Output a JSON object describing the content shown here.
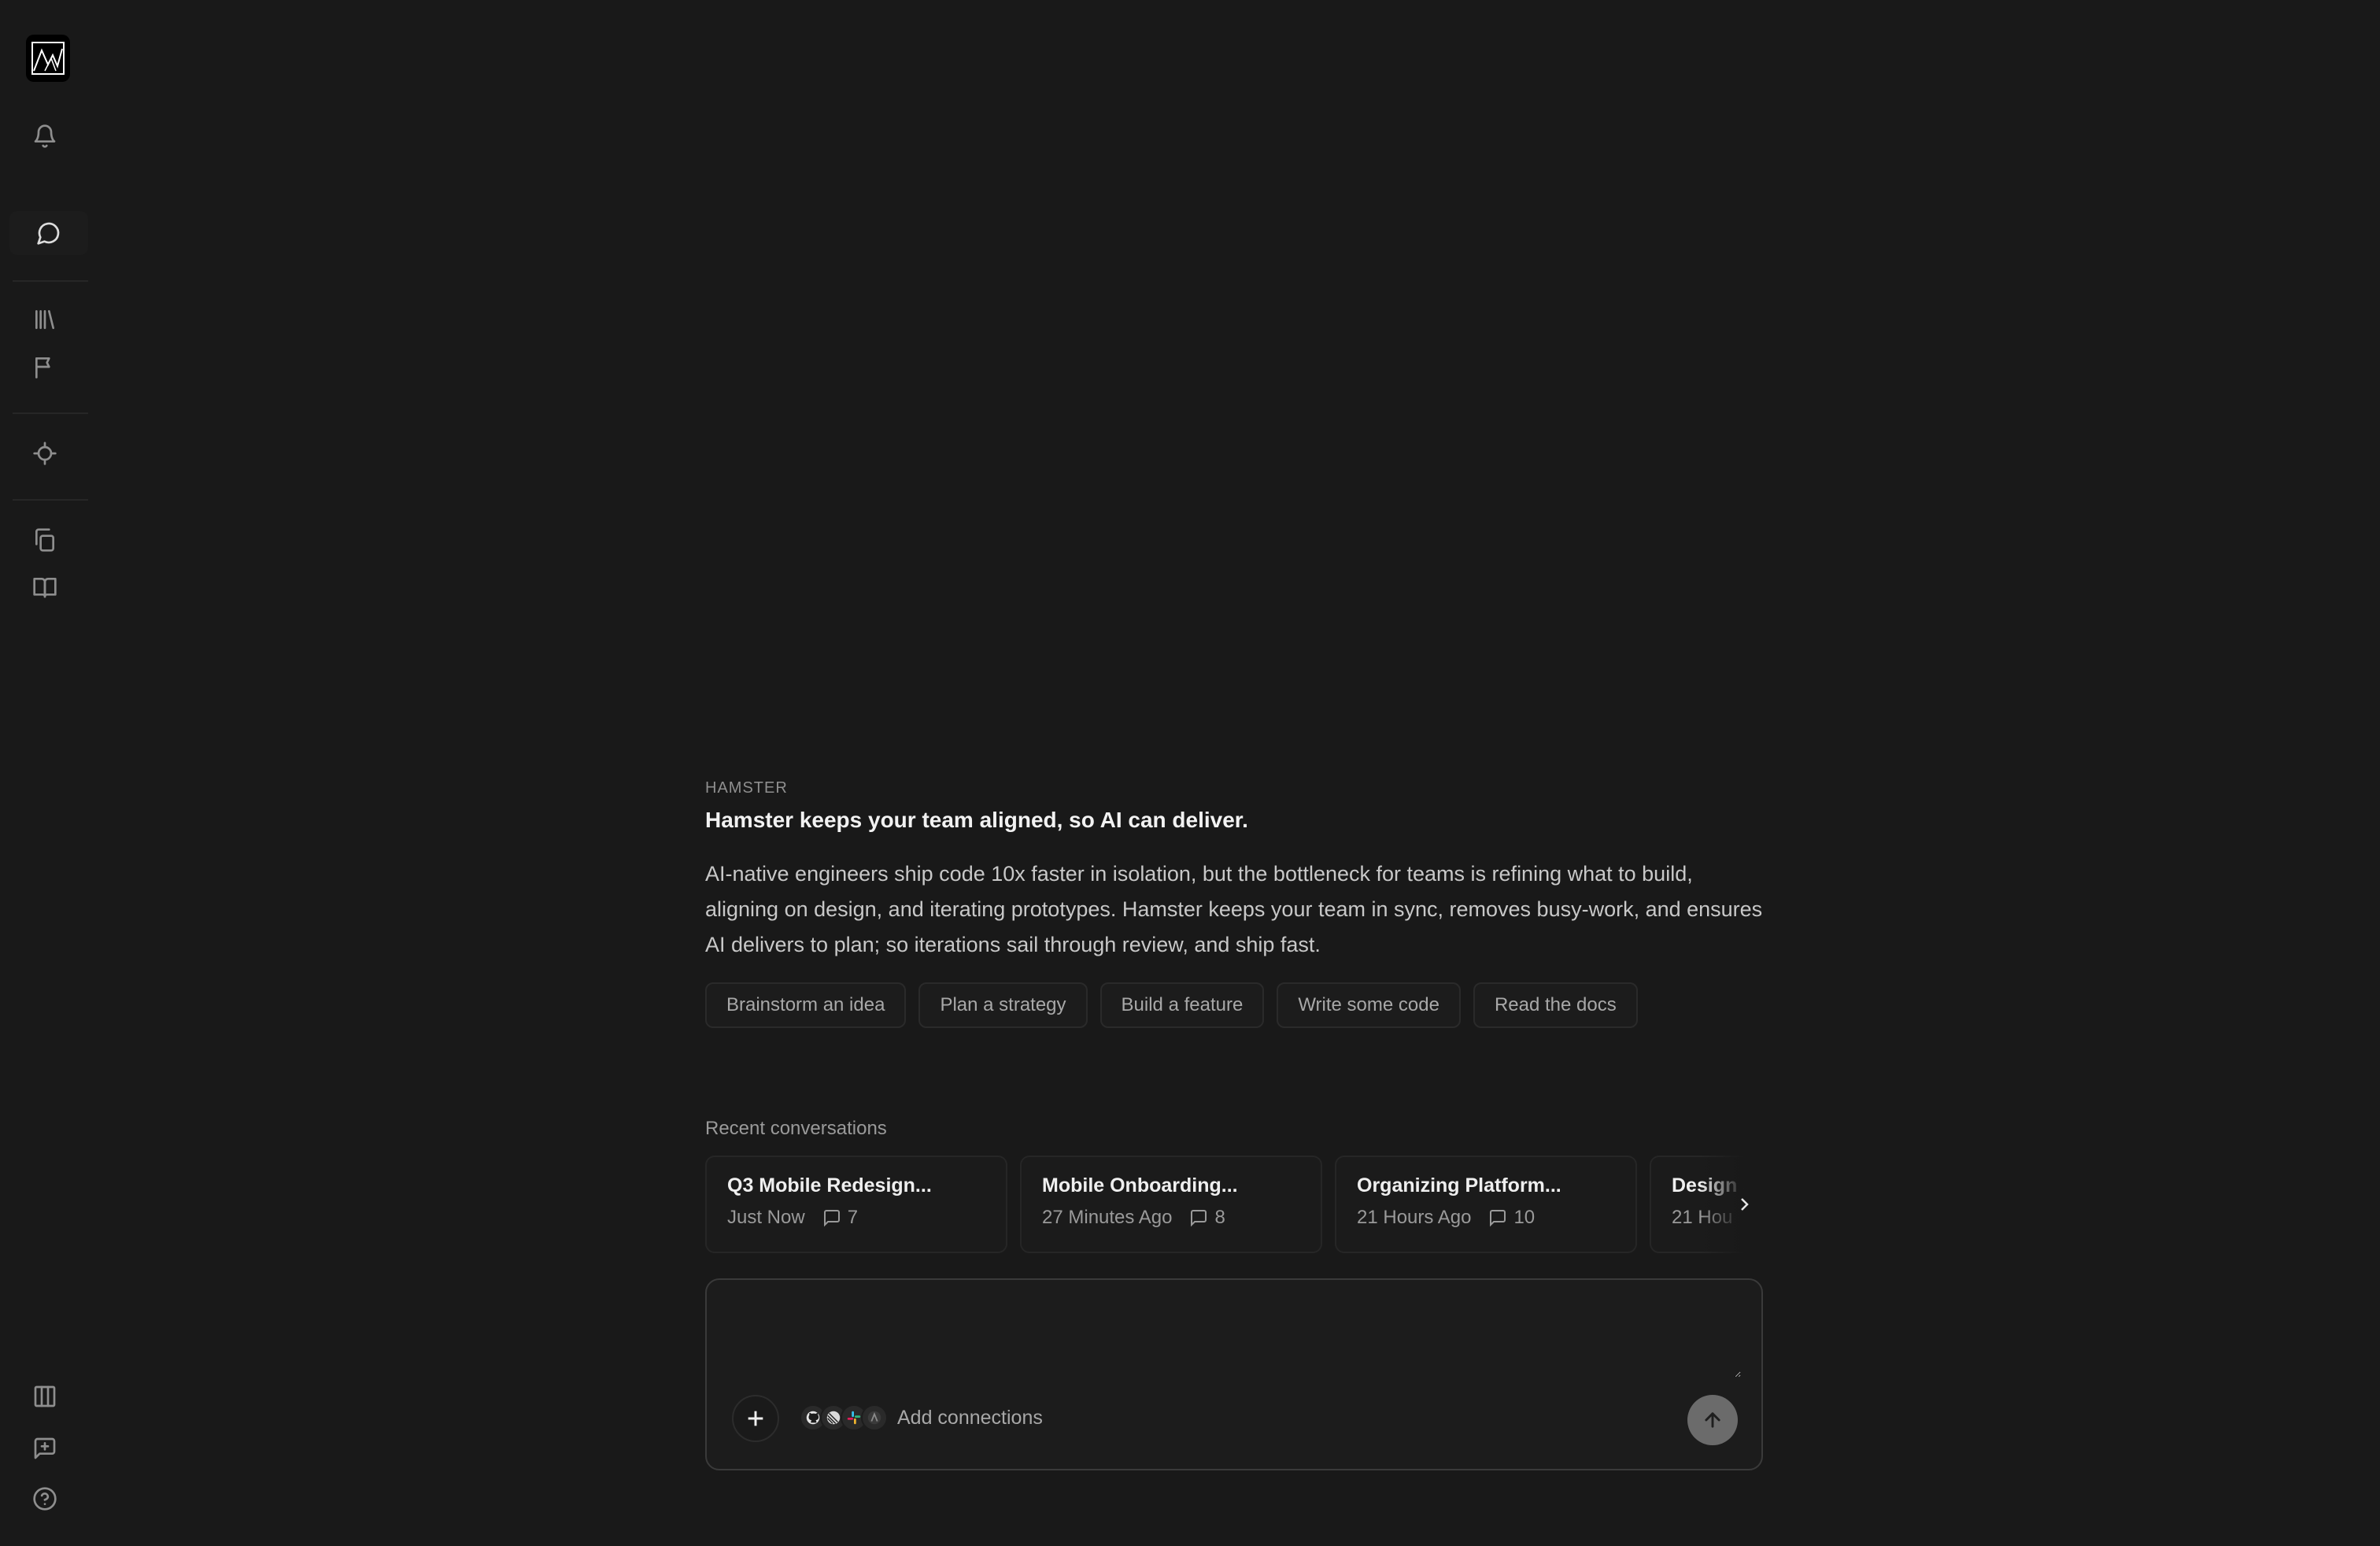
{
  "app": {
    "name": "Hamster"
  },
  "sidebar": {
    "items": [
      {
        "name": "bell-icon"
      },
      {
        "name": "chat-icon",
        "active": true
      },
      {
        "name": "library-icon"
      },
      {
        "name": "flag-icon"
      },
      {
        "name": "target-icon"
      },
      {
        "name": "copy-icon"
      },
      {
        "name": "book-icon"
      },
      {
        "name": "columns-icon"
      },
      {
        "name": "message-plus-icon"
      },
      {
        "name": "help-icon"
      }
    ]
  },
  "intro": {
    "eyebrow": "HAMSTER",
    "headline": "Hamster keeps your team aligned, so AI can deliver.",
    "description": "AI-native engineers ship code 10x faster in isolation, but the bottleneck for teams is refining what to build, aligning on design, and iterating prototypes. Hamster keeps your team in sync, removes busy-work, and ensures AI delivers to plan; so iterations sail through review, and ship fast."
  },
  "chips": [
    "Brainstorm an idea",
    "Plan a strategy",
    "Build a feature",
    "Write some code",
    "Read the docs"
  ],
  "recent": {
    "label": "Recent conversations",
    "items": [
      {
        "title": "Q3 Mobile Redesign...",
        "time": "Just Now",
        "comments": "7"
      },
      {
        "title": "Mobile Onboarding...",
        "time": "27 Minutes Ago",
        "comments": "8"
      },
      {
        "title": "Organizing Platform...",
        "time": "21 Hours Ago",
        "comments": "10"
      },
      {
        "title": "Design Sy",
        "time": "21 Hou",
        "comments": ""
      }
    ]
  },
  "composer": {
    "placeholder": "",
    "connections_label": "Add connections",
    "connection_icons": [
      "github-icon",
      "linear-icon",
      "slack-icon",
      "figma-icon"
    ]
  },
  "colors": {
    "background": "#191919",
    "send_button": "#6b6b6b"
  }
}
